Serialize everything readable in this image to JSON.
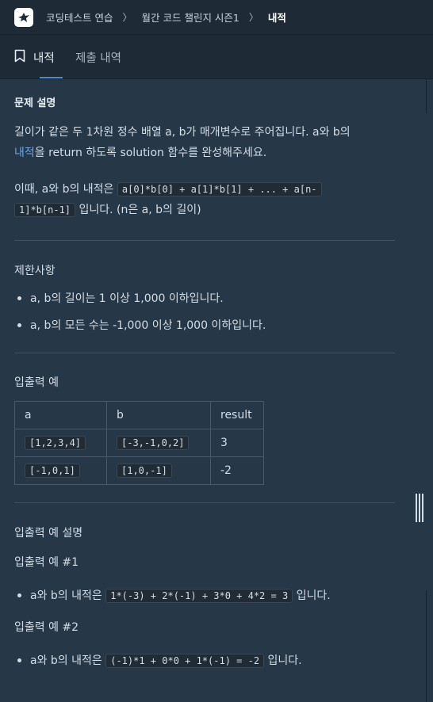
{
  "breadcrumb": {
    "items": [
      "코딩테스트 연습",
      "월간 코드 챌린지 시즌1"
    ],
    "current": "내적",
    "separator": "〉"
  },
  "tabs": {
    "active_label": "내적",
    "second_label": "제출 내역"
  },
  "problem": {
    "section_title": "문제 설명",
    "desc_line1": "길이가 같은 두 1차원 정수 배열 a, b가 매개변수로 주어집니다. a와 b의",
    "desc_link": "내적",
    "desc_line2_rest": "을 return 하도록 solution 함수를 완성해주세요.",
    "detail_prefix": "이때, a와 b의 내적은 ",
    "detail_code1": "a[0]*b[0] + a[1]*b[1] + ... + a[n-",
    "detail_code2": "1]*b[n-1]",
    "detail_suffix": " 입니다. (n은 a, b의 길이)"
  },
  "constraints": {
    "title": "제한사항",
    "items": [
      "a, b의 길이는 1 이상 1,000 이하입니다.",
      "a, b의 모든 수는 -1,000 이상 1,000 이하입니다."
    ]
  },
  "examples": {
    "title": "입출력 예",
    "headers": [
      "a",
      "b",
      "result"
    ],
    "rows": [
      {
        "a": "[1,2,3,4]",
        "b": "[-3,-1,0,2]",
        "result": "3"
      },
      {
        "a": "[-1,0,1]",
        "b": "[1,0,-1]",
        "result": "-2"
      }
    ]
  },
  "explanation": {
    "title": "입출력 예 설명",
    "case1_title": "입출력 예 #1",
    "case1_prefix": "a와 b의 내적은 ",
    "case1_code": "1*(-3) + 2*(-1) + 3*0 + 4*2 = 3",
    "case1_suffix": " 입니다.",
    "case2_title": "입출력 예 #2",
    "case2_prefix": "a와 b의 내적은 ",
    "case2_code": "(-1)*1 + 0*0 + 1*(-1) = -2",
    "case2_suffix": " 입니다."
  },
  "colors": {
    "background": "#263747",
    "topbar": "#1e2b37",
    "link": "#69a7ea",
    "tab_accent": "#4f89c6"
  }
}
